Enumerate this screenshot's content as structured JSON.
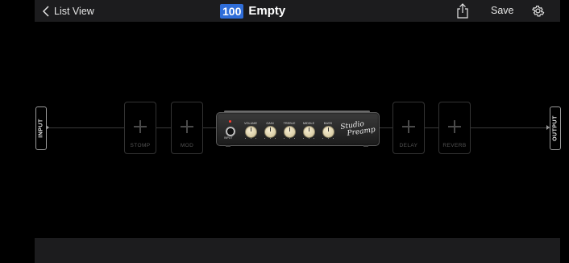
{
  "header": {
    "back_label": "List View",
    "preset_number": "100",
    "preset_name": "Empty",
    "save_label": "Save",
    "icons": [
      "chevron-left-icon",
      "share-icon",
      "gear-icon"
    ]
  },
  "chain": {
    "input_label": "INPUT",
    "output_label": "OUTPUT",
    "slots_before_amp": [
      {
        "label": "STOMP"
      },
      {
        "label": "MOD"
      }
    ],
    "slots_after_amp": [
      {
        "label": "DELAY"
      },
      {
        "label": "REVERB"
      }
    ],
    "amp": {
      "input_label": "INPUT",
      "brand_line1": "Studio",
      "brand_line2": "Preamp",
      "knobs": [
        {
          "label": "VOLUME"
        },
        {
          "label": "GAIN"
        },
        {
          "label": "TREBLE"
        },
        {
          "label": "MIDDLE"
        },
        {
          "label": "BASS"
        }
      ]
    }
  },
  "colors": {
    "background": "#000000",
    "bar": "#1c1c1e",
    "preset_badge": "#2f6dd8"
  }
}
